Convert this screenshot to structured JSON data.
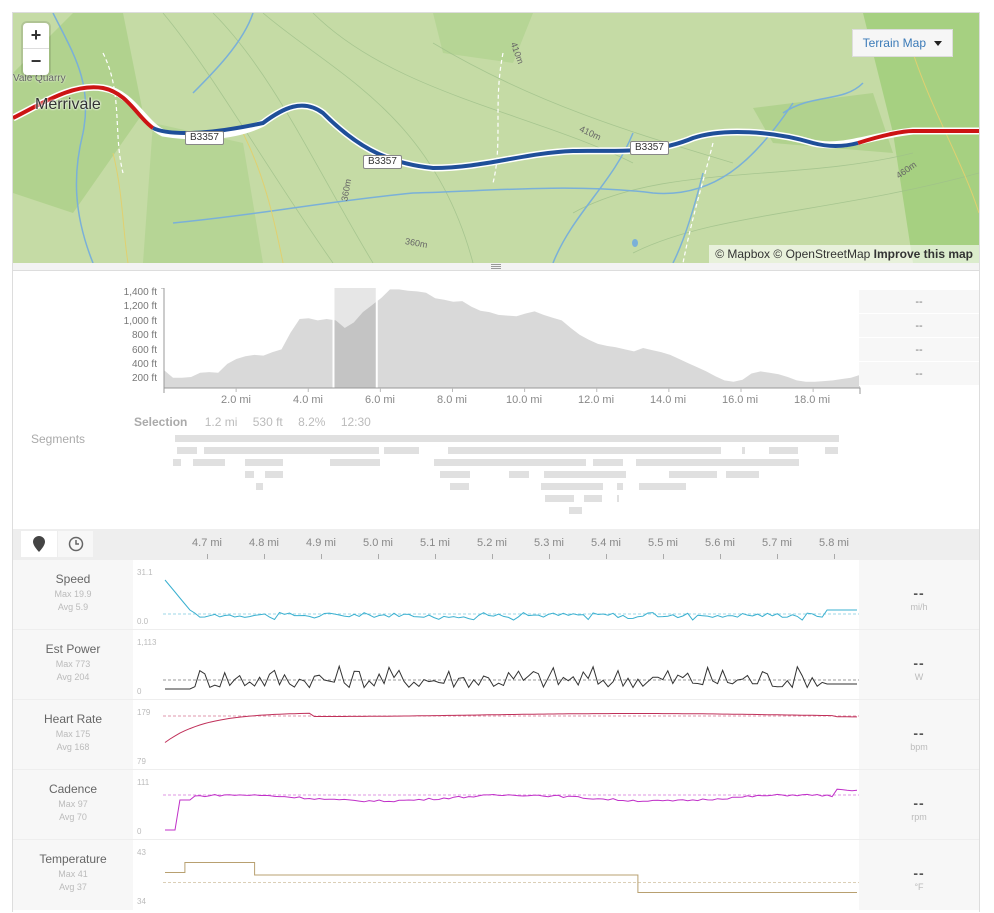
{
  "map": {
    "zoom_in": "+",
    "zoom_out": "−",
    "town_label": "Merrivale",
    "quarry_label": "Vale Quarry",
    "road_labels": [
      "B3357",
      "B3357",
      "B3357"
    ],
    "contour_labels": [
      "410m",
      "410m",
      "360m",
      "360m",
      "460m"
    ],
    "layer_button": "Terrain Map",
    "attribution_mapbox": "© Mapbox",
    "attribution_osm": "© OpenStreetMap",
    "attribution_improve": "Improve this map",
    "route_colors": {
      "outside_selection": "#cc1414",
      "selection": "#1f4f99"
    }
  },
  "elevation": {
    "y_ticks": [
      "1,400 ft",
      "1,200 ft",
      "1,000 ft",
      "800 ft",
      "600 ft",
      "400 ft",
      "200 ft"
    ],
    "x_ticks": [
      "2.0 mi",
      "4.0 mi",
      "6.0 mi",
      "8.0 mi",
      "10.0 mi",
      "12.0 mi",
      "14.0 mi",
      "16.0 mi",
      "18.0 mi"
    ],
    "side_values": [
      "--",
      "--",
      "--",
      "--"
    ],
    "selection": {
      "label": "Selection",
      "distance": "1.2 mi",
      "elevation": "530 ft",
      "grade": "8.2%",
      "time": "12:30"
    },
    "segments_label": "Segments",
    "selection_range_mi": [
      4.7,
      5.9
    ],
    "profile_ft": [
      260,
      150,
      150,
      160,
      220,
      230,
      220,
      350,
      420,
      460,
      480,
      470,
      520,
      560,
      800,
      1000,
      1010,
      980,
      1000,
      980,
      870,
      950,
      1100,
      1200,
      1300,
      1430,
      1430,
      1410,
      1400,
      1380,
      1300,
      1280,
      1250,
      1260,
      1180,
      1120,
      1100,
      1060,
      1050,
      1040,
      1080,
      1110,
      1060,
      1020,
      980,
      870,
      770,
      700,
      640,
      610,
      590,
      560,
      530,
      580,
      550,
      520,
      480,
      420,
      360,
      300,
      240,
      170,
      110,
      90,
      120,
      210,
      240,
      220,
      200,
      160,
      110,
      90,
      90,
      100,
      110,
      130,
      150,
      190
    ]
  },
  "streams": {
    "view_buttons": [
      "distance-view",
      "time-view"
    ],
    "distance_ticks": [
      "4.7 mi",
      "4.8 mi",
      "4.9 mi",
      "5.0 mi",
      "5.1 mi",
      "5.2 mi",
      "5.3 mi",
      "5.4 mi",
      "5.5 mi",
      "5.6 mi",
      "5.7 mi",
      "5.8 mi"
    ],
    "rows": [
      {
        "name": "Speed",
        "max": "Max 19.9",
        "avg": "Avg 5.9",
        "y_max": "31.1",
        "y_min": "0.0",
        "value": "--",
        "unit": "mi/h",
        "color": "#3ab0d0"
      },
      {
        "name": "Est Power",
        "max": "Max 773",
        "avg": "Avg 204",
        "y_max": "1,113",
        "y_min": "0",
        "value": "--",
        "unit": "W",
        "color": "#333333"
      },
      {
        "name": "Heart Rate",
        "max": "Max 175",
        "avg": "Avg 168",
        "y_max": "179",
        "y_min": "79",
        "value": "--",
        "unit": "bpm",
        "color": "#c0305a"
      },
      {
        "name": "Cadence",
        "max": "Max 97",
        "avg": "Avg 70",
        "y_max": "111",
        "y_min": "0",
        "value": "--",
        "unit": "rpm",
        "color": "#c030c8"
      },
      {
        "name": "Temperature",
        "max": "Max 41",
        "avg": "Avg 37",
        "y_max": "43",
        "y_min": "34",
        "value": "--",
        "unit": "°F",
        "color": "#b8a070"
      }
    ]
  }
}
